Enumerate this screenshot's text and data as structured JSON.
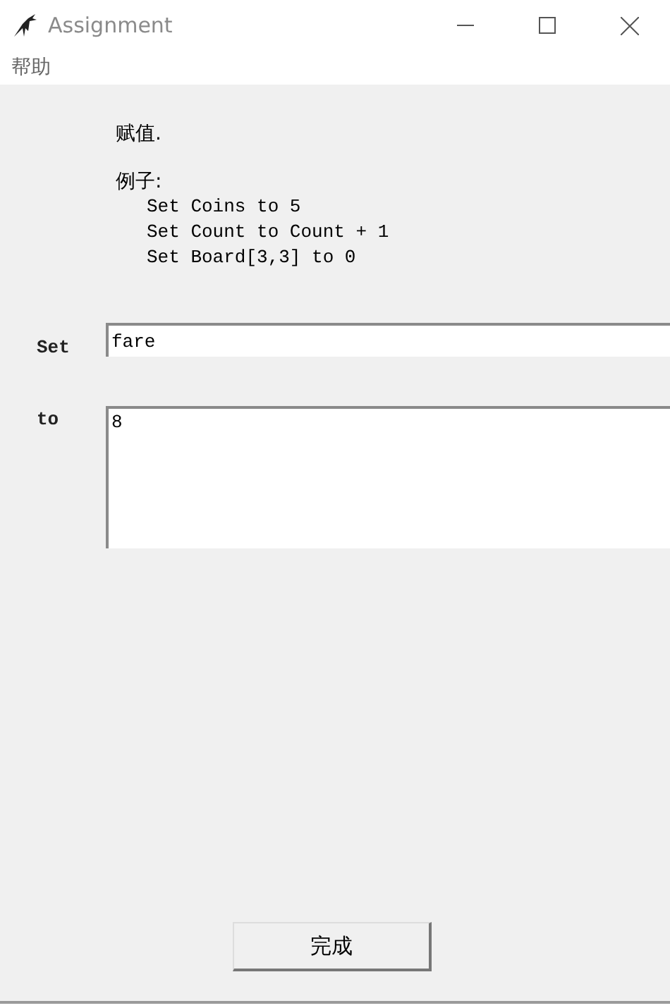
{
  "window": {
    "title": "Assignment"
  },
  "menu": [
    "帮助"
  ],
  "description": "赋值.",
  "examples_label": "例子:",
  "examples": [
    "Set Coins to 5",
    "Set Count to Count + 1",
    "Set Board[3,3] to 0"
  ],
  "fields": [
    {
      "label": "Set",
      "value": "fare",
      "kind": "line"
    },
    {
      "label": "to",
      "value": "8",
      "kind": "multiline"
    }
  ],
  "button": "完成"
}
